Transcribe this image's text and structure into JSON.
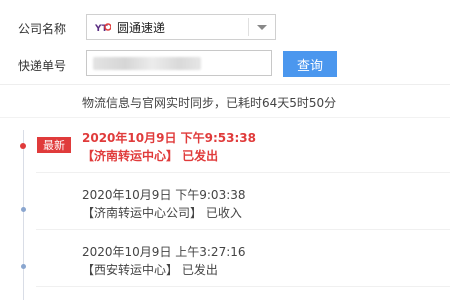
{
  "form": {
    "company_label": "公司名称",
    "tracking_label": "快递单号",
    "carrier": {
      "name": "圆通速递",
      "logo_icon": "yto-logo-icon"
    },
    "tracking_value": "",
    "query_button": "查询"
  },
  "sync_note": "物流信息与官网实时同步，已耗时64天5时50分",
  "latest_badge": "最新",
  "events": [
    {
      "time": "2020年10月9日 下午9:53:38",
      "location": "【济南转运中心】 已发出"
    },
    {
      "time": "2020年10月9日 下午9:03:38",
      "location": "【济南转运中心公司】 已收入"
    },
    {
      "time": "2020年10月9日 上午3:27:16",
      "location": "【西安转运中心】 已发出"
    }
  ],
  "colors": {
    "accent": "#4b97ee",
    "latest": "#e03b3b",
    "dot": "#8aa6cf"
  }
}
